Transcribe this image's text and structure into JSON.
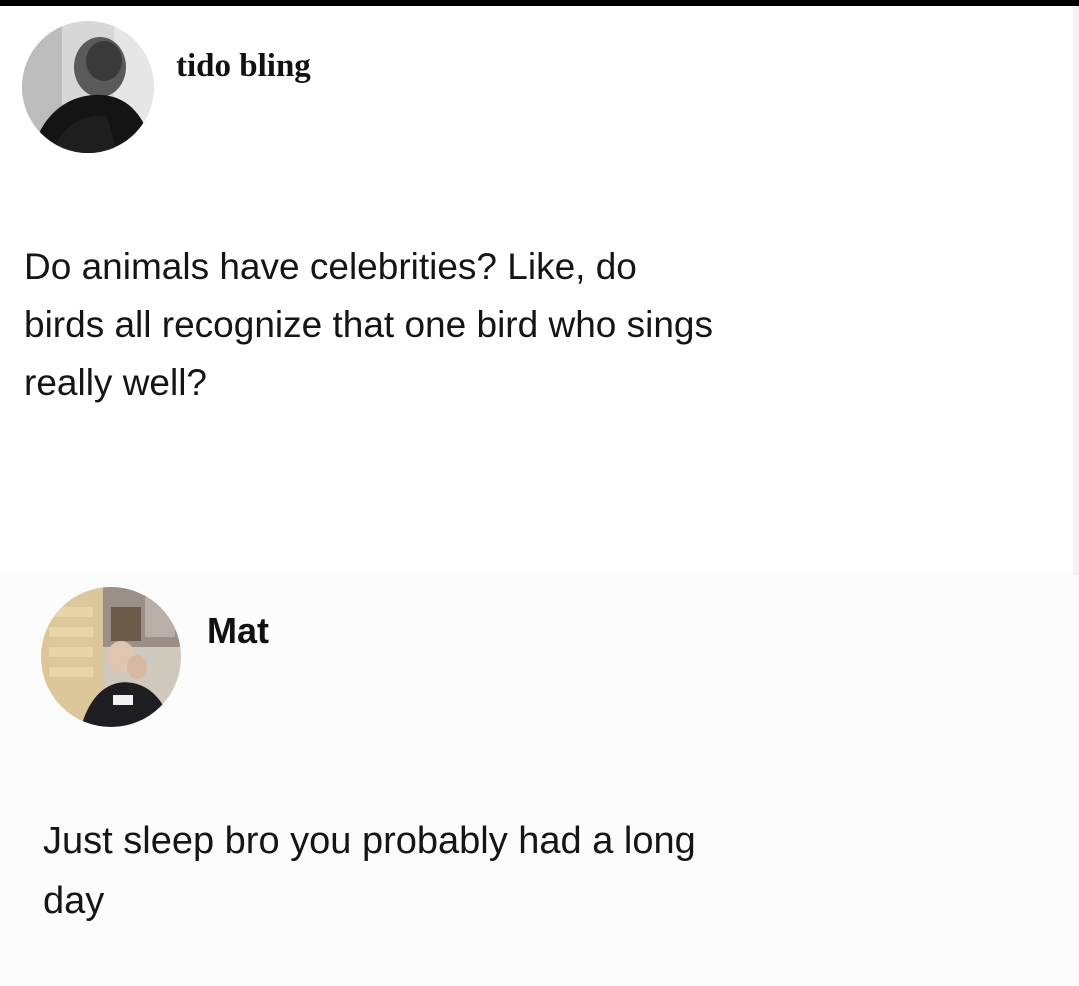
{
  "posts": [
    {
      "author": {
        "display_name": "tido bling",
        "avatar_icon": "profile-photo-dark-silhouette"
      },
      "text": "Do animals have celebrities? Like, do\nbirds all recognize that one bird who sings\nreally well?"
    },
    {
      "author": {
        "display_name": "Mat",
        "avatar_icon": "profile-photo-person-indoors"
      },
      "text": "Just sleep bro you probably had a long\nday"
    }
  ],
  "colors": {
    "background": "#ffffff",
    "text": "#151515",
    "top_bar": "#000000"
  }
}
